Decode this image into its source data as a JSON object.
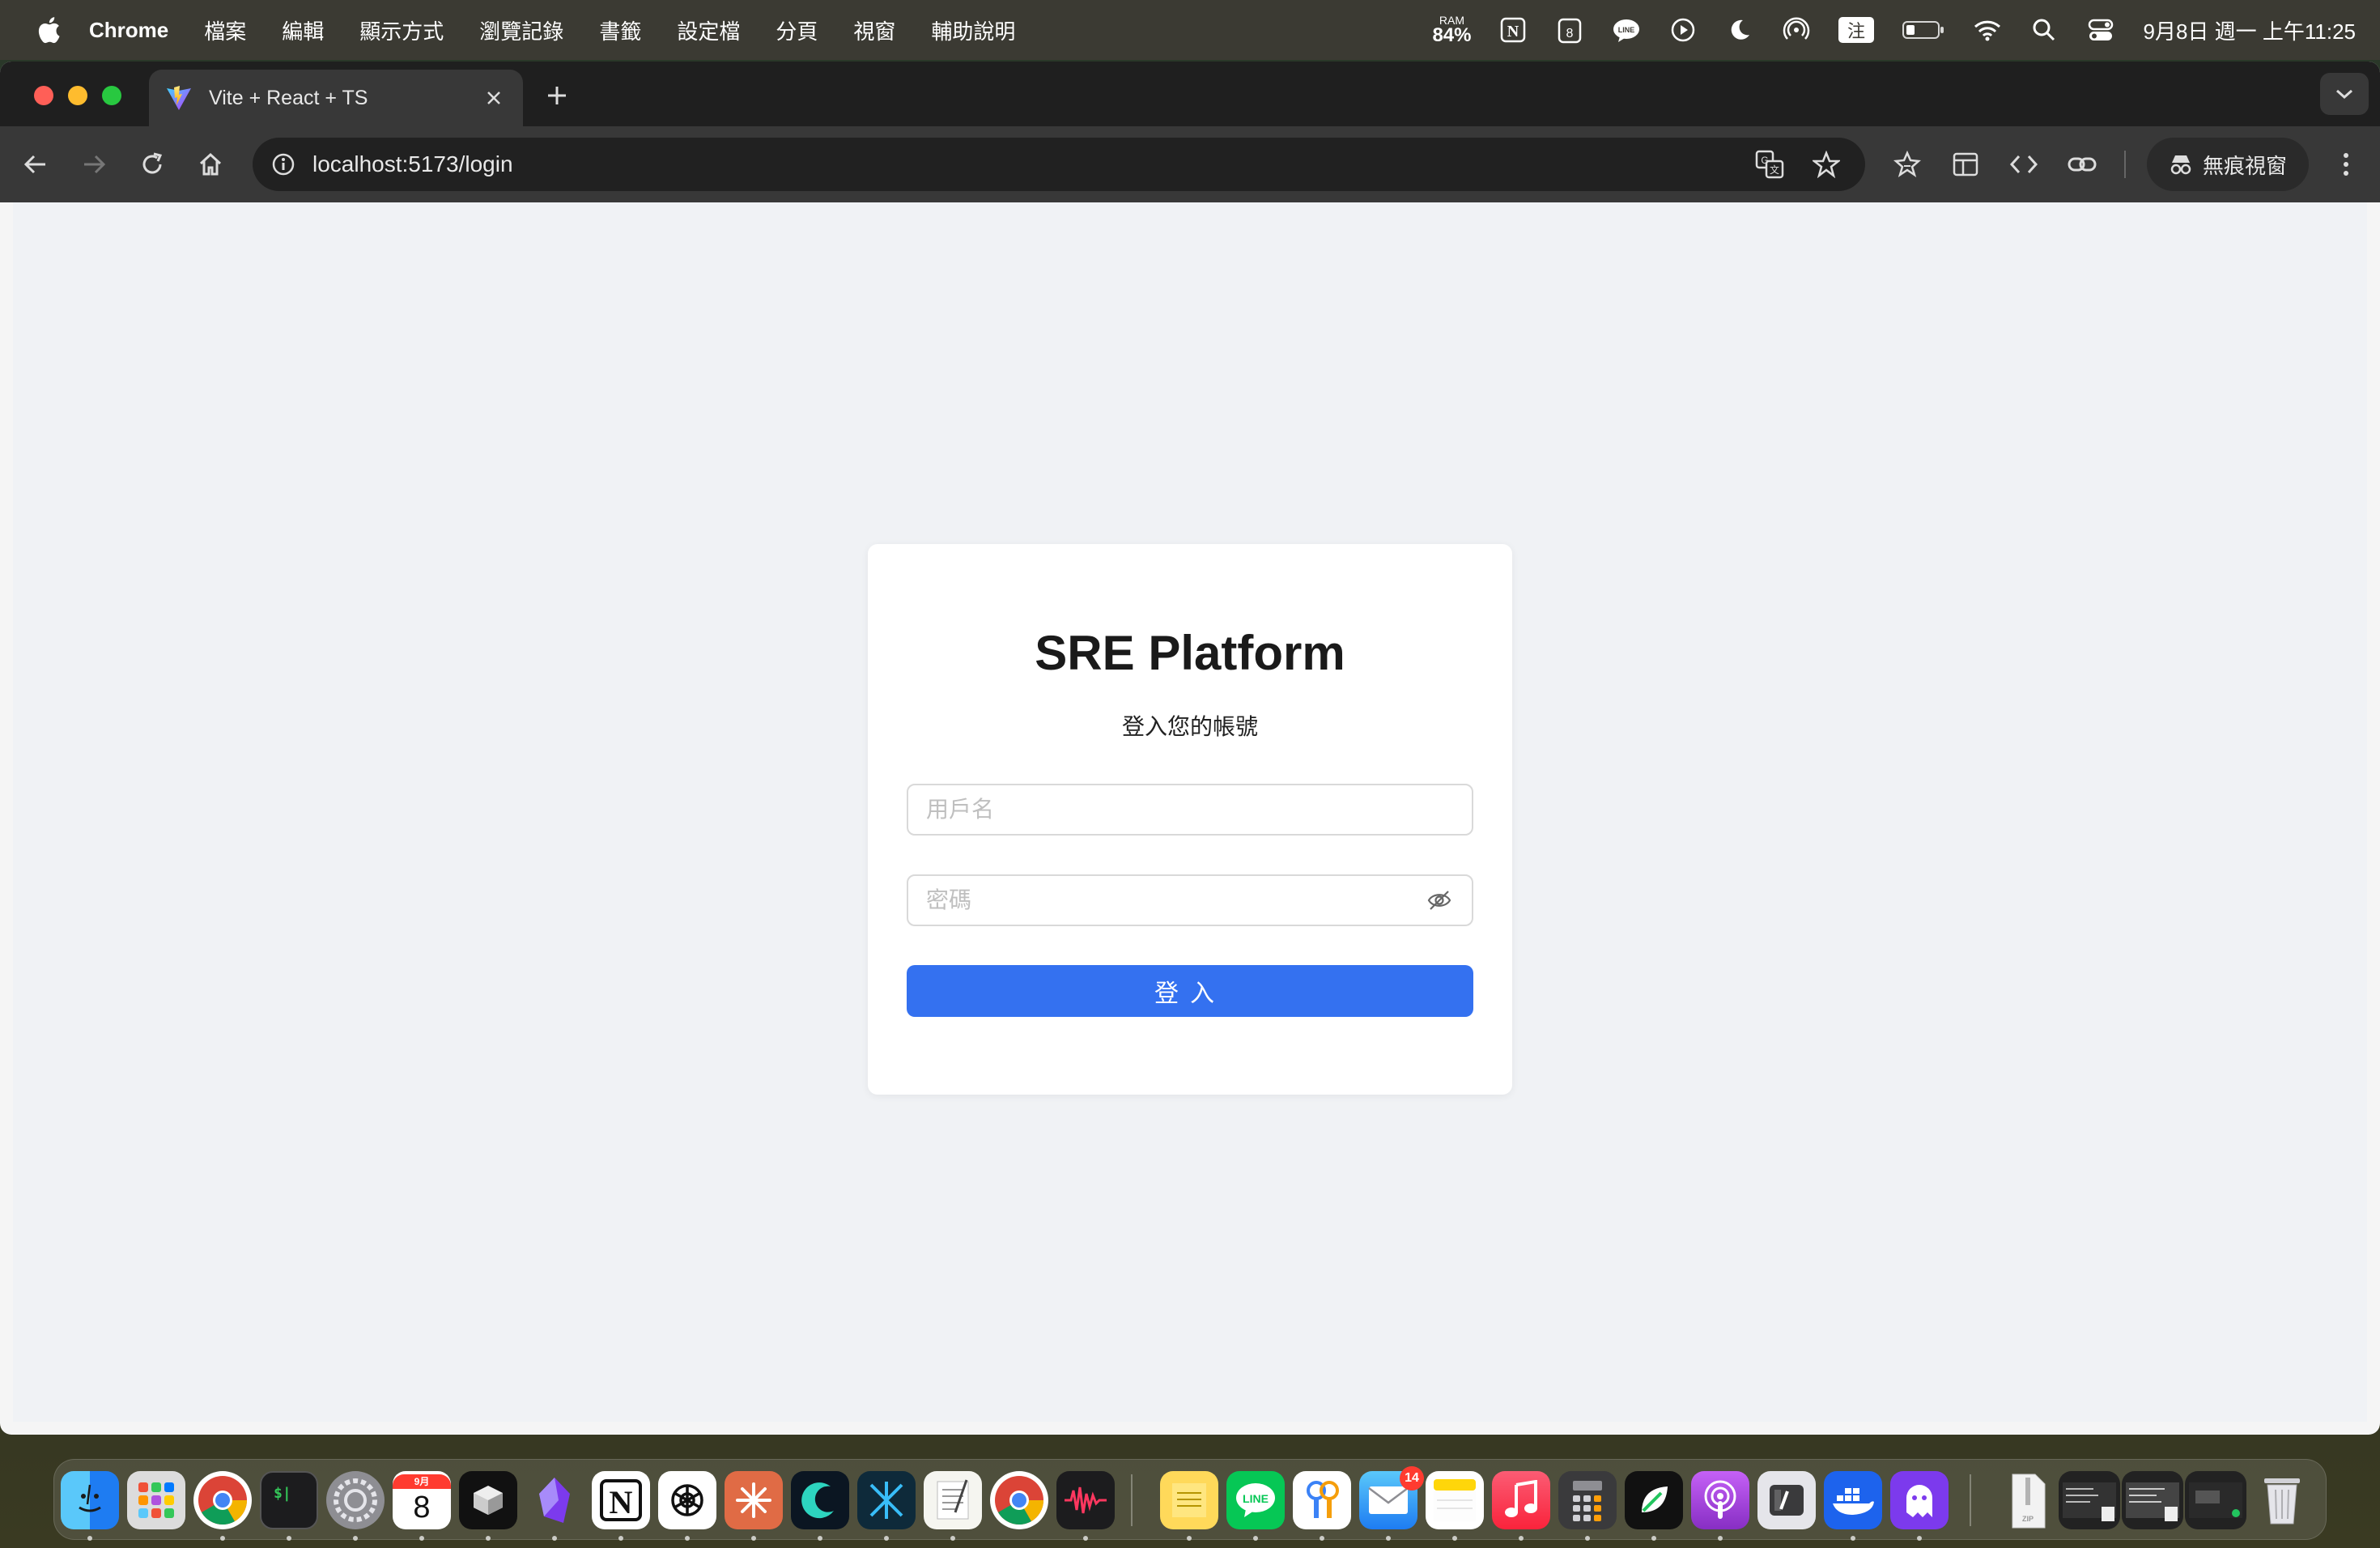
{
  "menubar": {
    "app_name": "Chrome",
    "items": [
      "檔案",
      "編輯",
      "顯示方式",
      "瀏覽記錄",
      "書籤",
      "設定檔",
      "分頁",
      "視窗",
      "輔助說明"
    ],
    "ram_label": "RAM",
    "ram_value": "84%",
    "input_method": "注",
    "calendar_day": "8",
    "clock": "9月8日 週一 上午11:25"
  },
  "browser": {
    "tab_title": "Vite + React + TS",
    "url": "localhost:5173/login",
    "incognito_label": "無痕視窗"
  },
  "login": {
    "title": "SRE Platform",
    "subtitle": "登入您的帳號",
    "username_placeholder": "用戶名",
    "password_placeholder": "密碼",
    "submit_label": "登入"
  },
  "dock": {
    "calendar_month": "9月",
    "calendar_day": "8",
    "mail_badge": "14"
  },
  "colors": {
    "primary_button": "#3471f0",
    "page_background": "#f0f2f5",
    "card_background": "#ffffff"
  }
}
